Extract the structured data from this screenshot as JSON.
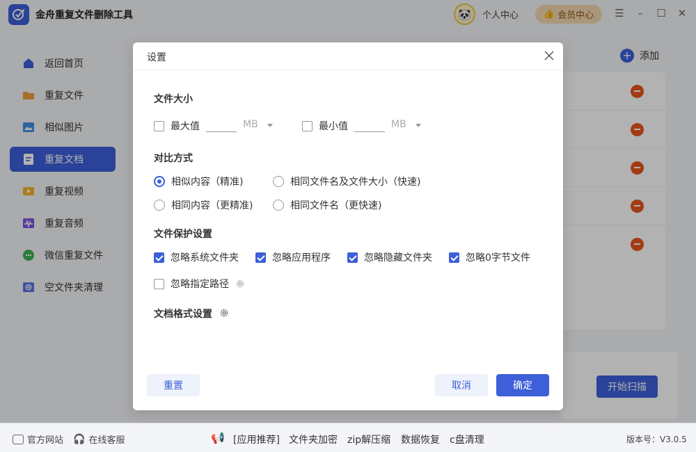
{
  "app": {
    "title": "金舟重复文件删除工具",
    "user_center": "个人中心",
    "vip_label": "会员中心"
  },
  "sidebar": {
    "items": [
      {
        "label": "返回首页",
        "color": "#3d5fd8"
      },
      {
        "label": "重复文件",
        "color": "#f0a13a"
      },
      {
        "label": "相似图片",
        "color": "#3f8fe8"
      },
      {
        "label": "重复文档",
        "color": "#ffffff",
        "active": true
      },
      {
        "label": "重复视频",
        "color": "#f5b22a"
      },
      {
        "label": "重复音频",
        "color": "#7a55e0"
      },
      {
        "label": "微信重复文件",
        "color": "#3fb14f"
      },
      {
        "label": "空文件夹清理",
        "color": "#5a76e6"
      }
    ]
  },
  "main": {
    "add_label": "添加",
    "start_scan": "开始扫描"
  },
  "dialog": {
    "title": "设置",
    "file_size": {
      "title": "文件大小",
      "max_label": "最大值",
      "max_unit": "MB",
      "max_value": "",
      "min_label": "最小值",
      "min_unit": "MB",
      "min_value": ""
    },
    "compare": {
      "title": "对比方式",
      "options": [
        {
          "label": "相似内容（精准)",
          "selected": true
        },
        {
          "label": "相同文件名及文件大小（快速)",
          "selected": false
        },
        {
          "label": "相同内容（更精准)",
          "selected": false
        },
        {
          "label": "相同文件名（更快速)",
          "selected": false
        }
      ]
    },
    "protect": {
      "title": "文件保护设置",
      "options": [
        {
          "label": "忽略系统文件夹",
          "checked": true
        },
        {
          "label": "忽略应用程序",
          "checked": true
        },
        {
          "label": "忽略隐藏文件夹",
          "checked": true
        },
        {
          "label": "忽略0字节文件",
          "checked": true
        },
        {
          "label": "忽略指定路径",
          "checked": false
        }
      ]
    },
    "doc_format": {
      "title": "文档格式设置"
    },
    "buttons": {
      "reset": "重置",
      "cancel": "取消",
      "ok": "确定"
    }
  },
  "footer": {
    "website": "官方网站",
    "service": "在线客服",
    "app_rec": "[应用推荐]",
    "rec_items": [
      "文件夹加密",
      "zip解压缩",
      "数据恢复",
      "c盘清理"
    ],
    "version": "版本号：V3.0.5"
  },
  "colors": {
    "accent": "#3d5fd8",
    "danger": "#e8551c",
    "vip": "#f4d9b0"
  }
}
